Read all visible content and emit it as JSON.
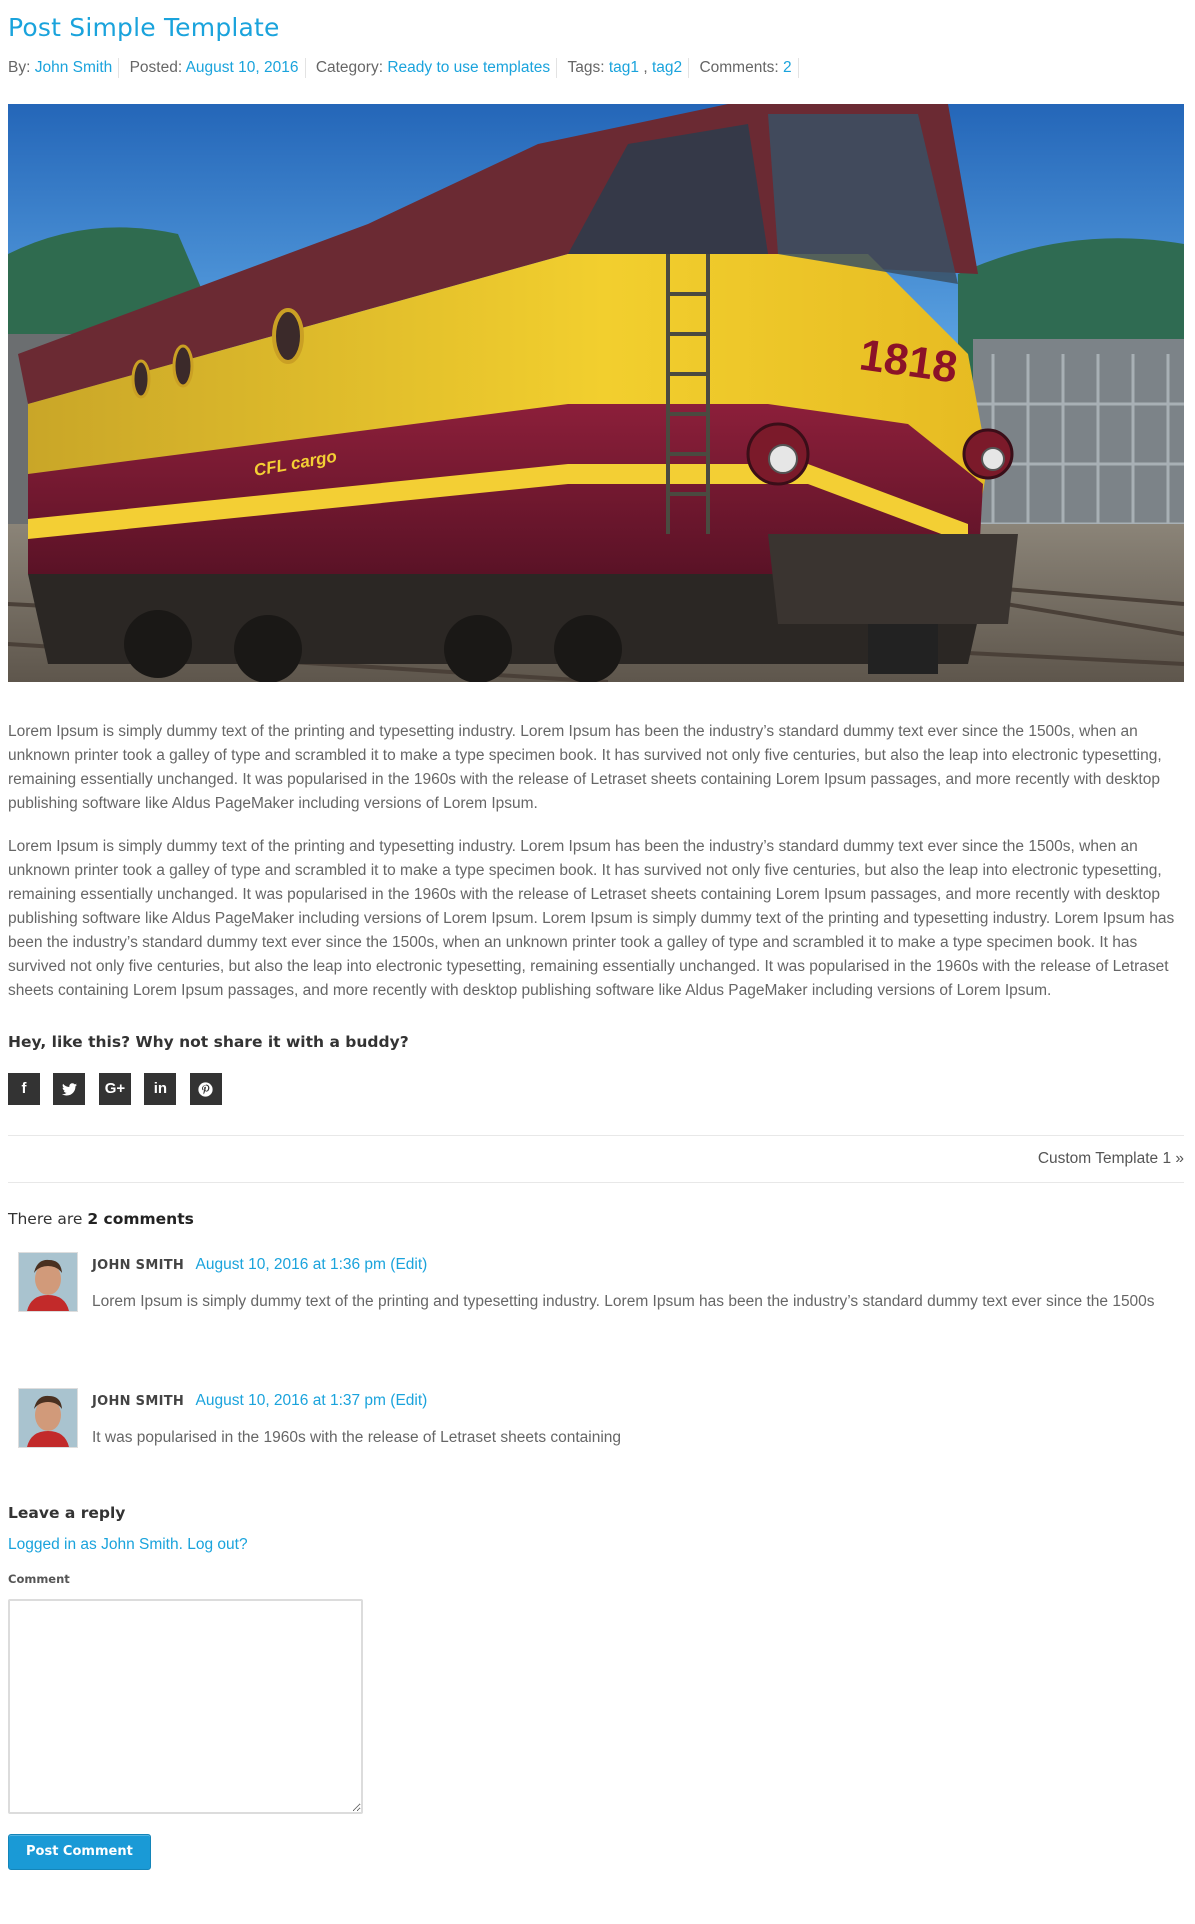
{
  "post": {
    "title": "Post Simple Template",
    "meta": {
      "by_label": "By:",
      "author": "John Smith",
      "posted_label": "Posted:",
      "date": "August 10, 2016",
      "category_label": "Category:",
      "category": "Ready to use templates",
      "tags_label": "Tags:",
      "tags": [
        "tag1",
        "tag2"
      ],
      "tag_separator": " , ",
      "comments_label": "Comments:",
      "comments_count": "2"
    },
    "hero_image": {
      "locomotive_number": "1818",
      "locomotive_logo": "CFL cargo"
    },
    "paragraphs": [
      "Lorem Ipsum is simply dummy text of the printing and typesetting industry. Lorem Ipsum has been the industry’s standard dummy text ever since the 1500s, when an unknown printer took a galley of type and scrambled it to make a type specimen book. It has survived not only five centuries, but also the leap into electronic typesetting, remaining essentially unchanged. It was popularised in the 1960s with the release of Letraset sheets containing Lorem Ipsum passages, and more recently with desktop publishing software like Aldus PageMaker including versions of Lorem Ipsum.",
      "Lorem Ipsum is simply dummy text of the printing and typesetting industry. Lorem Ipsum has been the industry’s standard dummy text ever since the 1500s, when an unknown printer took a galley of type and scrambled it to make a type specimen book. It has survived not only five centuries, but also the leap into electronic typesetting, remaining essentially unchanged. It was popularised in the 1960s with the release of Letraset sheets containing Lorem Ipsum passages, and more recently with desktop publishing software like Aldus PageMaker including versions of Lorem Ipsum. Lorem Ipsum is simply dummy text of the printing and typesetting industry. Lorem Ipsum has been the industry’s standard dummy text ever since the 1500s, when an unknown printer took a galley of type and scrambled it to make a type specimen book. It has survived not only five centuries, but also the leap into electronic typesetting, remaining essentially unchanged. It was popularised in the 1960s with the release of Letraset sheets containing Lorem Ipsum passages, and more recently with desktop publishing software like Aldus PageMaker including versions of Lorem Ipsum."
    ]
  },
  "share": {
    "title": "Hey, like this? Why not share it with a buddy?",
    "buttons": [
      {
        "name": "facebook-icon",
        "glyph": "f"
      },
      {
        "name": "twitter-icon",
        "glyph": ""
      },
      {
        "name": "google-plus-icon",
        "glyph": "G+"
      },
      {
        "name": "linkedin-icon",
        "glyph": "in"
      },
      {
        "name": "pinterest-icon",
        "glyph": ""
      }
    ]
  },
  "navigation": {
    "next_post": "Custom Template 1 »"
  },
  "comments": {
    "title_prefix": "There are ",
    "title_count": "2 comments",
    "items": [
      {
        "author": "JOHN SMITH",
        "date": "August 10, 2016 at 1:36 pm",
        "edit": "(Edit)",
        "text": "Lorem Ipsum is simply dummy text of the printing and typesetting industry. Lorem Ipsum has been the industry’s standard dummy text ever since the 1500s"
      },
      {
        "author": "JOHN SMITH",
        "date": "August 10, 2016 at 1:37 pm",
        "edit": "(Edit)",
        "text": "It was popularised in the 1960s with the release of Letraset sheets containing"
      }
    ]
  },
  "reply": {
    "title": "Leave a reply",
    "logged_in": "Logged in as John Smith",
    "logout": "Log out?",
    "comment_label": "Comment",
    "comment_value": "",
    "submit_label": "Post Comment"
  },
  "colors": {
    "accent": "#1aa3dc",
    "text": "#666666",
    "heading": "#333333",
    "share_button": "#333333",
    "submit_button": "#1a9ad6"
  }
}
